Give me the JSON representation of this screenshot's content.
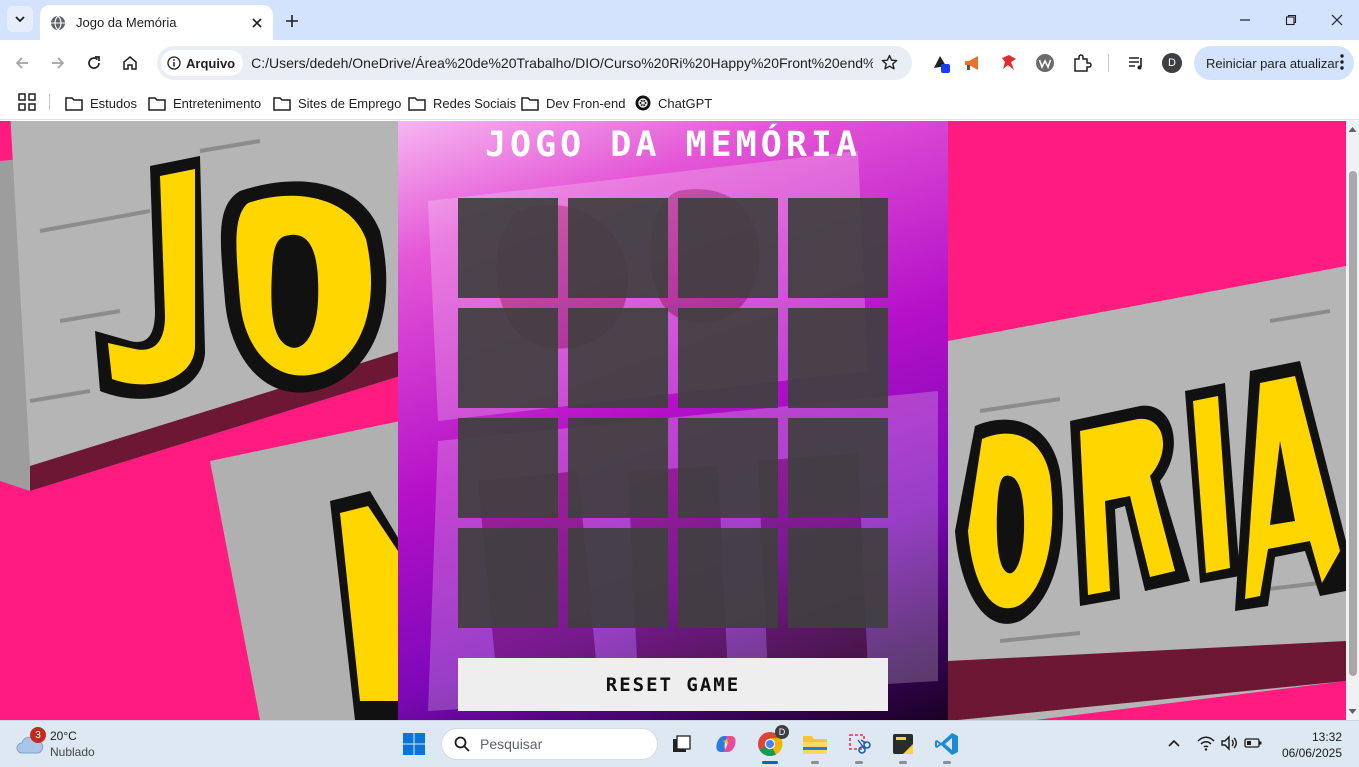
{
  "browser": {
    "tab_title": "Jogo da Memória",
    "chip_label": "Arquivo",
    "url": "C:/Users/dedeh/OneDrive/Área%20de%20Trabalho/DIO/Curso%20Ri%20Happy%20Front%20end%...",
    "profile_initial": "D",
    "update_button": "Reiniciar para atualizar"
  },
  "bookmarks": [
    {
      "label": "Estudos",
      "icon": "folder-icon"
    },
    {
      "label": "Entretenimento",
      "icon": "folder-icon"
    },
    {
      "label": "Sites de Emprego",
      "icon": "folder-icon"
    },
    {
      "label": "Redes Sociais",
      "icon": "folder-icon"
    },
    {
      "label": "Dev Fron-end",
      "icon": "folder-icon"
    },
    {
      "label": "ChatGPT",
      "icon": "chatgpt-icon"
    }
  ],
  "page": {
    "title": "JOGO DA MEMÓRIA",
    "reset_button": "RESET GAME",
    "card_count": 16,
    "colors": {
      "background": "#ff1b80",
      "card_back": "#404040",
      "panel_top": "#e455d6",
      "panel_bottom": "#1a0224"
    }
  },
  "taskbar": {
    "weather_temp": "20°C",
    "weather_condition": "Nublado",
    "weather_badge": "3",
    "search_placeholder": "Pesquisar",
    "chrome_badge": "D",
    "time": "13:32",
    "date": "06/06/2025"
  }
}
